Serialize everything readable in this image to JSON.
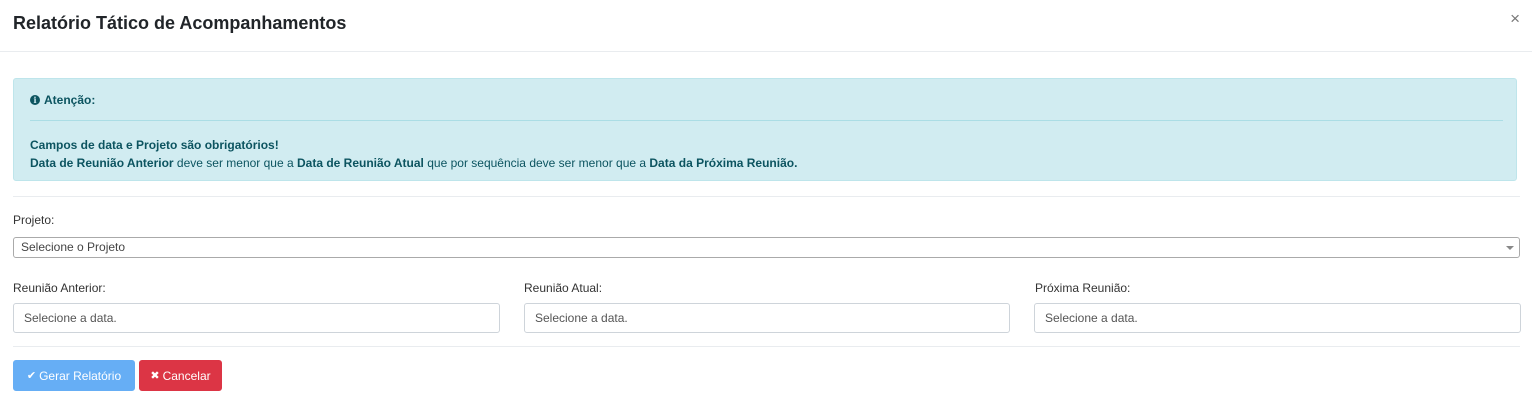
{
  "modal": {
    "title": "Relatório Tático de Acompanhamentos",
    "close_icon": "×"
  },
  "alert": {
    "icon": "info-circle",
    "icon_glyph": "i",
    "heading": "Atenção:",
    "line1": "Campos de data e Projeto são obrigatórios!",
    "line2": {
      "b1": "Data de Reunião Anterior",
      "t1": " deve ser menor que a ",
      "b2": "Data de Reunião Atual",
      "t2": " que por sequência deve ser menor que a ",
      "b3": "Data da Próxima Reunião."
    }
  },
  "form": {
    "projeto_label": "Projeto:",
    "projeto_selected": "Selecione o Projeto",
    "reuniao_anterior_label": "Reunião Anterior:",
    "reuniao_anterior_placeholder": "Selecione a data.",
    "reuniao_atual_label": "Reunião Atual:",
    "reuniao_atual_placeholder": "Selecione a data.",
    "proxima_reuniao_label": "Próxima Reunião:",
    "proxima_reuniao_placeholder": "Selecione a data."
  },
  "actions": {
    "generate_icon": "✔",
    "generate_label": "Gerar Relatório",
    "cancel_icon": "✖",
    "cancel_label": "Cancelar"
  },
  "colors": {
    "alert_bg": "#d1ecf1",
    "alert_text": "#0c5460",
    "primary": "#66aef5",
    "danger": "#dc3545"
  }
}
